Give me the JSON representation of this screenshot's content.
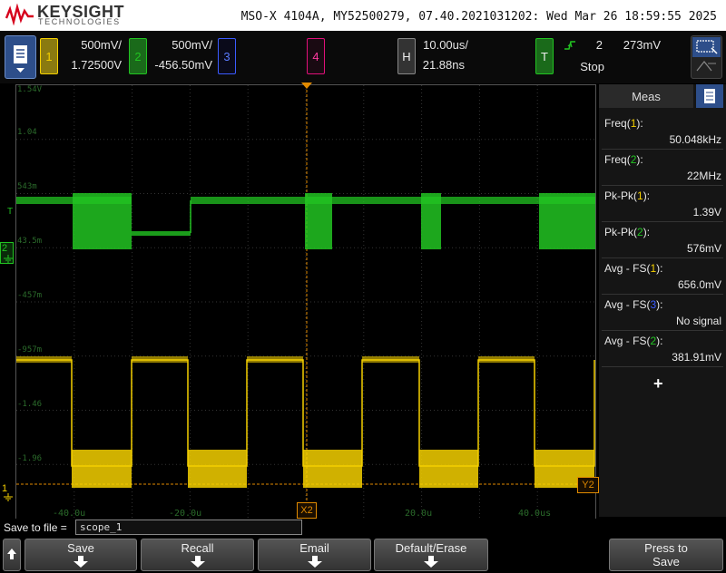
{
  "header": {
    "brand": "KEYSIGHT",
    "brand_sub": "TECHNOLOGIES",
    "instrument_info": "MSO-X 4104A, MY52500279, 07.40.2021031202: Wed Mar 26 18:59:55 2025"
  },
  "channels": [
    {
      "num": "1",
      "scale": "500mV/",
      "offset": "1.72500V",
      "color": "#f5d000"
    },
    {
      "num": "2",
      "scale": "500mV/",
      "offset": "-456.50mV",
      "color": "#22c422"
    },
    {
      "num": "3",
      "color": "#3b5bff"
    },
    {
      "num": "4",
      "color": "#e0107a"
    }
  ],
  "horizontal": {
    "label": "H",
    "timebase": "10.00us/",
    "delay": "21.88ns"
  },
  "trigger": {
    "label": "T",
    "source": "2",
    "level": "273mV",
    "status": "Stop"
  },
  "display": {
    "volt_labels": [
      "1.54V",
      "1.04",
      "543m",
      "43.5m",
      "-457m",
      "-957m",
      "-1.46",
      "-1.96"
    ],
    "time_labels": [
      "-40.0u",
      "-20.0u",
      "20.0u",
      "40.0us"
    ],
    "cursor_x2": "X2",
    "cursor_y2": "Y2",
    "marker_t": "T",
    "marker_ch2": "2",
    "marker_ch1": "1"
  },
  "meas": {
    "title": "Meas",
    "rows": [
      {
        "name": "Freq",
        "ch": "1",
        "value": "50.048kHz",
        "ch_color": "#f5d000"
      },
      {
        "name": "Freq",
        "ch": "2",
        "value": "22MHz",
        "ch_color": "#22c422"
      },
      {
        "name": "Pk-Pk",
        "ch": "1",
        "value": "1.39V",
        "ch_color": "#f5d000"
      },
      {
        "name": "Pk-Pk",
        "ch": "2",
        "value": "576mV",
        "ch_color": "#22c422"
      },
      {
        "name": "Avg - FS",
        "ch": "1",
        "value": "656.0mV",
        "ch_color": "#f5d000"
      },
      {
        "name": "Avg - FS",
        "ch": "3",
        "value": "No signal",
        "ch_color": "#3b5bff"
      },
      {
        "name": "Avg - FS",
        "ch": "2",
        "value": "381.91mV",
        "ch_color": "#22c422"
      }
    ],
    "add": "+"
  },
  "save": {
    "label": "Save to file =",
    "filename": "scope_1"
  },
  "softkeys": {
    "save": "Save",
    "recall": "Recall",
    "email": "Email",
    "default": "Default/Erase",
    "press1": "Press to",
    "press2": "Save"
  },
  "colors": {
    "ch1": "#f5d000",
    "ch2": "#22c422",
    "ch3": "#3b5bff",
    "ch4": "#e0107a",
    "accent": "#2d4e8a",
    "cursor": "#e08a00"
  }
}
